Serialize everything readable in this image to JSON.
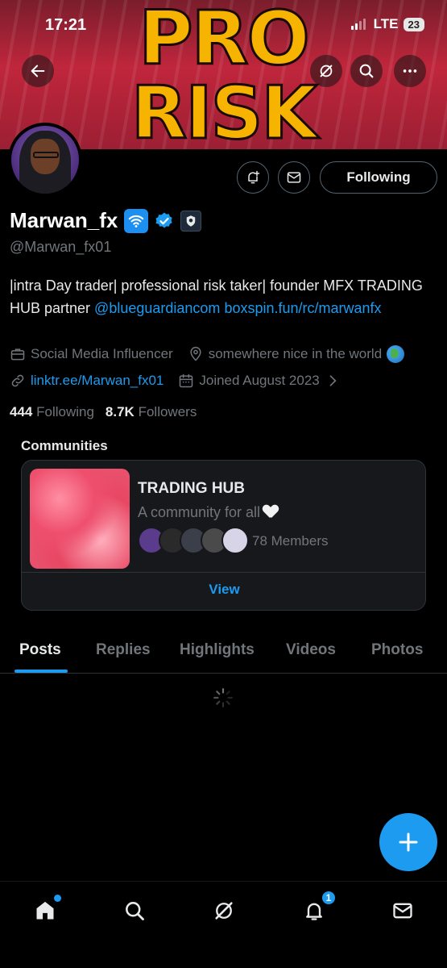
{
  "status_bar": {
    "time": "17:21",
    "network": "LTE",
    "battery": "23"
  },
  "banner": {
    "line1": "PRO",
    "line2": "RISK TAKER"
  },
  "top_actions": {
    "back_icon": "arrow-left-icon",
    "grok_icon": "grok-icon",
    "search_icon": "search-icon",
    "more_icon": "more-horizontal-icon"
  },
  "profile": {
    "display_name": "Marwan_fx",
    "handle": "@Marwan_fx01",
    "follow_button": "Following",
    "bio_text": "|intra Day trader| professional risk taker| founder MFX TRADING HUB partner ",
    "bio_mention": "@blueguardiancom",
    "bio_link": "boxspin.fun/rc/marwanfx",
    "category": "Social Media Influencer",
    "location": "somewhere nice in the world",
    "website": "linktr.ee/Marwan_fx01",
    "joined": "Joined August 2023",
    "following_count": "444",
    "following_label": "Following",
    "followers_count": "8.7K",
    "followers_label": "Followers"
  },
  "communities": {
    "heading": "Communities",
    "card": {
      "name": "TRADING HUB",
      "description": "A community for all",
      "members": "78 Members",
      "view_label": "View"
    }
  },
  "tabs": [
    {
      "label": "Posts",
      "active": true
    },
    {
      "label": "Replies",
      "active": false
    },
    {
      "label": "Highlights",
      "active": false
    },
    {
      "label": "Videos",
      "active": false
    },
    {
      "label": "Photos",
      "active": false
    }
  ],
  "bottom_nav": {
    "home_icon": "home-icon",
    "search_icon": "search-icon",
    "grok_icon": "grok-icon",
    "notifications_icon": "bell-icon",
    "notifications_badge": "1",
    "messages_icon": "mail-icon"
  },
  "colors": {
    "accent": "#1d9bf0",
    "background": "#000000",
    "muted": "#71767b",
    "banner_text": "#f6b400"
  }
}
